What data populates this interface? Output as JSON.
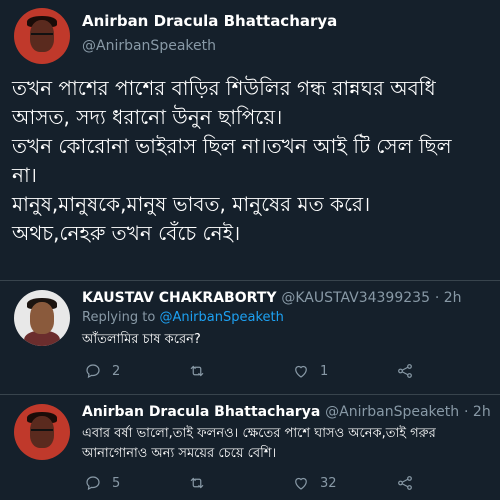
{
  "tweet": {
    "author_name": "Anirban Dracula Bhattacharya",
    "author_handle": "@AnirbanSpeaketh",
    "lines": [
      "তখন পাশের পাশের বাড়ির শিউলির গন্ধ রান্নঘর অবধি",
      "আসত, সদ্য ধরানো উনুন ছাপিয়ে।",
      "তখন কোরোনা ভাইরাস ছিল না।তখন আই টি সেল ছিল",
      "না।",
      "মানুষ,মানুষকে,মানুষ ভাবত, মানুষের মত করে।",
      "অথচ,নেহরু তখন বেঁচে নেই।"
    ]
  },
  "replies": [
    {
      "author_name": "KAUSTAV CHAKRABORTY",
      "author_handle": "@KAUSTAV34399235",
      "time": "· 2h",
      "replying_label": "Replying to ",
      "replying_handle": "@AnirbanSpeaketh",
      "text": "আঁতলামির চাষ করেন?",
      "reply_count": "2",
      "retweet_count": "",
      "like_count": "1"
    },
    {
      "author_name": "Anirban Dracula Bhattacharya",
      "author_handle": "@AnirbanSpeaketh",
      "time": "· 2h",
      "text": "এবার বর্ষা ভালো,তাই ফলনও। ক্ষেতের পাশে ঘাসও অনেক,তাই গরুর আনাগোনাও অন্য সময়ের চেয়ে বেশি।",
      "reply_count": "5",
      "retweet_count": "",
      "like_count": "32"
    }
  ],
  "icons": {
    "reply": "reply-icon",
    "retweet": "retweet-icon",
    "like": "heart-icon",
    "share": "share-icon"
  },
  "colors": {
    "background": "#15202b",
    "text": "#ffffff",
    "muted": "#8899a6",
    "link": "#1da1f2",
    "divider": "#38444d"
  }
}
